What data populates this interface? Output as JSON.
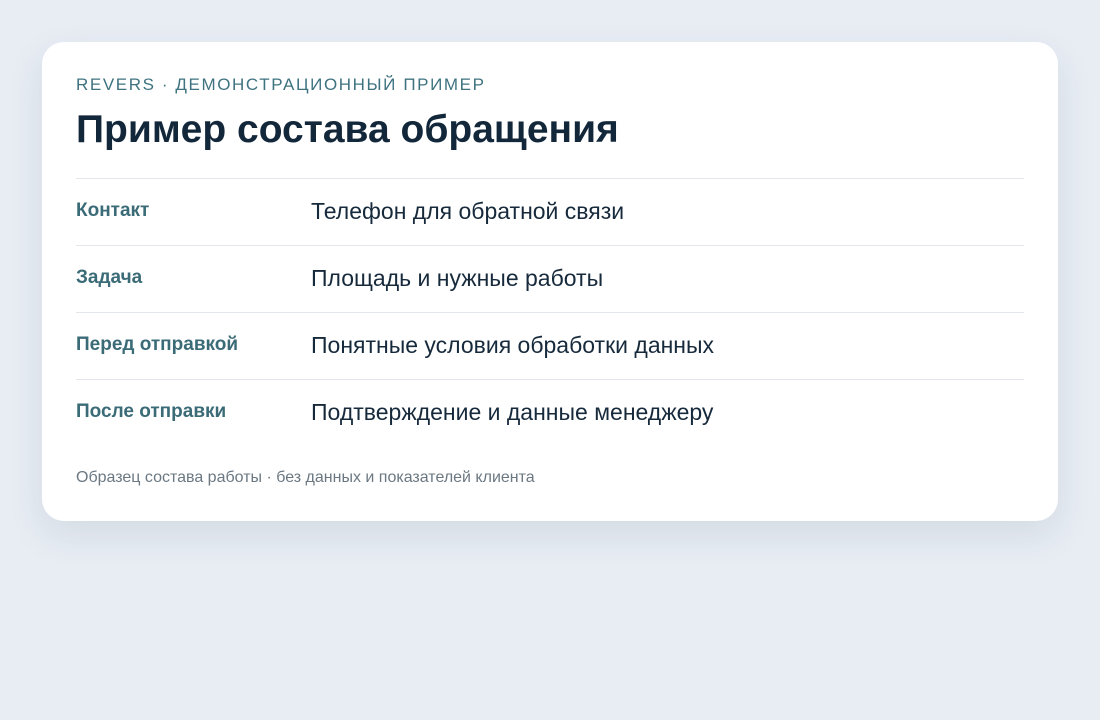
{
  "header": {
    "eyebrow": "REVERS · ДЕМОНСТРАЦИОННЫЙ ПРИМЕР",
    "title": "Пример состава обращения"
  },
  "rows": [
    {
      "label": "Контакт",
      "value": "Телефон для обратной связи"
    },
    {
      "label": "Задача",
      "value": "Площадь и нужные работы"
    },
    {
      "label": "Перед отправкой",
      "value": "Понятные условия обработки данных"
    },
    {
      "label": "После отправки",
      "value": "Подтверждение и данные менеджеру"
    }
  ],
  "footnote": "Образец состава работы · без данных и показателей клиента",
  "colors": {
    "background": "#e8edf4",
    "card": "#ffffff",
    "accent": "#3a6b77",
    "text": "#13273a",
    "muted": "#6b7882"
  }
}
